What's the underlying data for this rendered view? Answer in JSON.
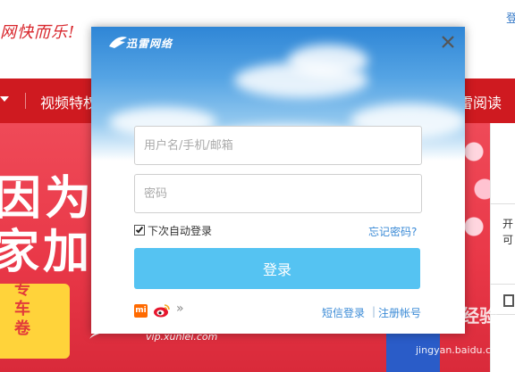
{
  "background_page": {
    "slogan": "网快而乐!",
    "top_right_link": "登",
    "nav": {
      "item_partial_left": "视频特权",
      "item_partial_right": "雷阅读"
    },
    "banner": {
      "headline_line1": "因为都",
      "headline_line2": "家加",
      "ticket_text": "专车",
      "ticket_text2": "卷",
      "vip_url": "vip.xunlei.com"
    },
    "right_panel": {
      "text1": "开",
      "text2": "可"
    },
    "watermark": {
      "brand": "Bai du 经验",
      "url": "jingyan.baidu.com"
    }
  },
  "login_dialog": {
    "logo_text": "迅雷网络",
    "username_placeholder": "用户名/手机/邮箱",
    "password_placeholder": "密码",
    "remember_me_label": "下次自动登录",
    "remember_me_checked": true,
    "forgot_password_label": "忘记密码?",
    "login_button_label": "登录",
    "third_party_icons": [
      "xiaomi-icon",
      "weibo-icon",
      "more-icon"
    ],
    "xiaomi_label": "mi",
    "more_label": "»",
    "sms_login_label": "短信登录",
    "separator": "|",
    "register_label": "注册帐号",
    "colors": {
      "primary_button": "#55c3f2",
      "link": "#3a8ad6",
      "nav_red": "#cf1a20"
    }
  }
}
